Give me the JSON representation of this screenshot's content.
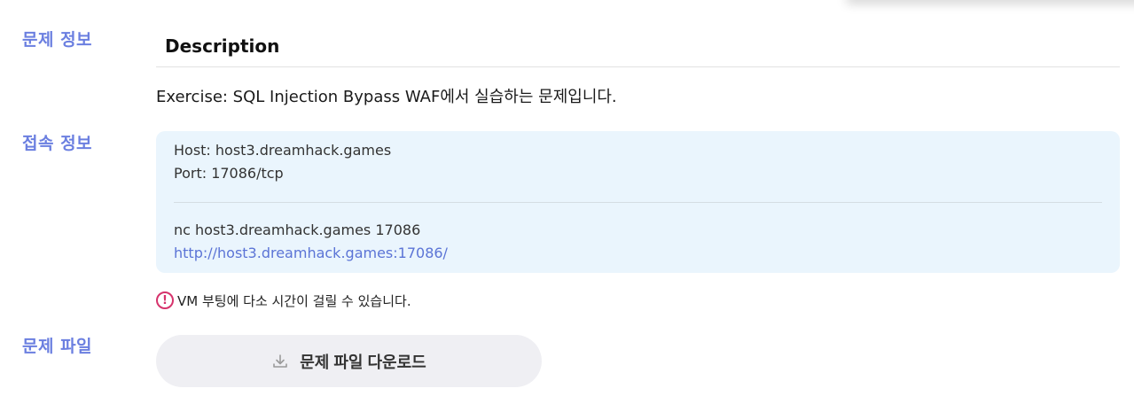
{
  "sections": {
    "problem_info_label": "문제 정보",
    "connection_info_label": "접속 정보",
    "problem_file_label": "문제 파일"
  },
  "description": {
    "title": "Description",
    "text": "Exercise: SQL Injection Bypass WAF에서 실습하는 문제입니다."
  },
  "connection": {
    "host_line": "Host: host3.dreamhack.games",
    "port_line": "Port: 17086/tcp",
    "nc_command": "nc host3.dreamhack.games 17086",
    "url": "http://host3.dreamhack.games:17086/"
  },
  "notice": {
    "icon": "exclamation-circle-icon",
    "text": "VM 부팅에 다소 시간이 걸릴 수 있습니다."
  },
  "download": {
    "icon": "download-icon",
    "label": "문제 파일 다운로드"
  },
  "colors": {
    "section_label": "#6b7fe0",
    "connection_bg": "#eaf5fd",
    "link": "#5b74d6",
    "notice_icon": "#d6336c",
    "button_bg": "#efeff3"
  }
}
